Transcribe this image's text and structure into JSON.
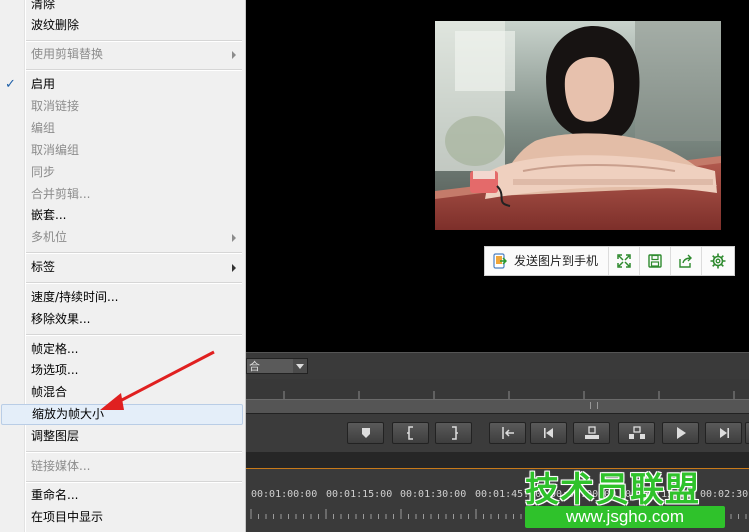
{
  "context_menu": {
    "items": [
      {
        "label": "清除",
        "disabled": false
      },
      {
        "label": "波纹删除",
        "disabled": false
      },
      {
        "label": "使用剪辑替换",
        "disabled": true,
        "submenu": true
      },
      {
        "label": "启用",
        "disabled": false,
        "checked": true
      },
      {
        "label": "取消链接",
        "disabled": true
      },
      {
        "label": "编组",
        "disabled": true
      },
      {
        "label": "取消编组",
        "disabled": true
      },
      {
        "label": "同步",
        "disabled": true
      },
      {
        "label": "合并剪辑...",
        "disabled": true
      },
      {
        "label": "嵌套...",
        "disabled": false
      },
      {
        "label": "多机位",
        "disabled": true,
        "submenu": true
      },
      {
        "label": "标签",
        "disabled": false,
        "submenu": true
      },
      {
        "label": "速度/持续时间...",
        "disabled": false
      },
      {
        "label": "移除效果...",
        "disabled": false
      },
      {
        "label": "帧定格...",
        "disabled": false
      },
      {
        "label": "场选项...",
        "disabled": false
      },
      {
        "label": "帧混合",
        "disabled": false
      },
      {
        "label": "缩放为帧大小",
        "disabled": false,
        "highlighted": true
      },
      {
        "label": "调整图层",
        "disabled": false
      },
      {
        "label": "链接媒体...",
        "disabled": true
      },
      {
        "label": "重命名...",
        "disabled": false
      },
      {
        "label": "在项目中显示",
        "disabled": false
      }
    ],
    "check_mark": "✓"
  },
  "image_toolbar": {
    "send_to_phone": "发送图片到手机",
    "icons": [
      "fullscreen-icon",
      "save-icon",
      "share-icon",
      "settings-icon"
    ]
  },
  "timeline": {
    "dropdown_value": "合",
    "timecodes": [
      "00:01:00:00",
      "00:01:15:00",
      "00:01:30:00",
      "00:01:45:00",
      "00:02:00:00",
      "00:02:15:00",
      "00:02:30:00"
    ],
    "controls": [
      "marker-icon",
      "mark-in-icon",
      "mark-out-icon",
      "go-to-in-icon",
      "step-back-icon",
      "lift-icon",
      "extract-icon",
      "play-icon",
      "step-forward-icon"
    ]
  },
  "watermark": {
    "title": "技术员联盟",
    "url": "www.jsgho.com"
  },
  "colors": {
    "menu_bg": "#f0f0f0",
    "highlight_bg": "#e4eef9",
    "annotation_arrow": "#e02020",
    "watermark_green": "#2fc22b"
  }
}
